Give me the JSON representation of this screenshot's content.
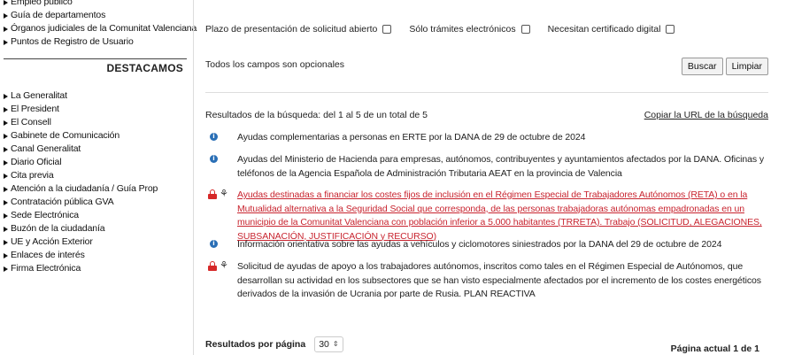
{
  "sidebar": {
    "top_items": [
      {
        "label": "Empleo público"
      },
      {
        "label": "Guía de departamentos"
      },
      {
        "label": "Órganos judiciales de la Comunitat Valenciana"
      },
      {
        "label": "Puntos de Registro de Usuario"
      }
    ],
    "section_title": "DESTACAMOS",
    "items": [
      {
        "label": "La Generalitat"
      },
      {
        "label": "El President"
      },
      {
        "label": "El Consell"
      },
      {
        "label": "Gabinete de Comunicación"
      },
      {
        "label": "Canal Generalitat"
      },
      {
        "label": "Diario Oficial"
      },
      {
        "label": "Cita previa"
      },
      {
        "label": "Atención a la ciudadanía / Guía Prop"
      },
      {
        "label": "Contratación pública GVA"
      },
      {
        "label": "Sede Electrónica"
      },
      {
        "label": "Buzón de la ciudadanía"
      },
      {
        "label": "UE y Acción Exterior"
      },
      {
        "label": "Enlaces de interés"
      },
      {
        "label": "Firma Electrónica"
      }
    ]
  },
  "filters": {
    "options": [
      {
        "label": "Plazo de presentación de solicitud abierto",
        "checked": false
      },
      {
        "label": "Sólo trámites electrónicos",
        "checked": false
      },
      {
        "label": "Necesitan certificado digital",
        "checked": false
      }
    ],
    "optional_note": "Todos los campos son opcionales",
    "search_button": "Buscar",
    "clear_button": "Limpiar"
  },
  "results": {
    "summary": "Resultados de la búsqueda: del 1 al 5 de un total de 5",
    "copy_link": "Copiar la URL de la búsqueda",
    "items": [
      {
        "type": "info",
        "icon": "info-icon",
        "text": "Ayudas complementarias a personas en ERTE por la DANA de 29 de octubre de 2024",
        "is_link": false
      },
      {
        "type": "info",
        "icon": "info-icon",
        "text": "Ayudas del Ministerio de Hacienda para empresas, autónomos, contribuyentes y ayuntamientos afectados por la DANA. Oficinas y teléfonos de la Agencia Española de Administración Tributaria AEAT en la provincia de Valencia",
        "is_link": false
      },
      {
        "type": "procedure",
        "icon": "lock-icon",
        "text": "Ayudas destinadas a financiar los costes fijos de inclusión en el Régimen Especial de Trabajadores Autónomos (RETA) o en la Mutualidad alternativa a la Seguridad Social que corresponda, de las personas trabajadoras autónomas empadronadas en un municipio de la Comunitat Valenciana con población inferior a 5.000 habitantes (TRRETA). Trabajo (SOLICITUD, ALEGACIONES, SUBSANACIÓN, JUSTIFICACIÓN y RECURSO)",
        "is_link": true
      },
      {
        "type": "info",
        "icon": "info-icon",
        "text": "Información orientativa sobre las ayudas a vehículos y ciclomotores siniestrados por la DANA del 29 de octubre de 2024",
        "is_link": false
      },
      {
        "type": "procedure",
        "icon": "lock-icon",
        "text": "Solicitud de ayudas de apoyo a los trabajadores autónomos, inscritos como tales en el Régimen Especial de Autónomos, que desarrollan su actividad en los subsectores que se han visto especialmente afectados por el incremento de los costes energéticos derivados de la invasión de Ucrania por parte de Rusia. PLAN REACTIVA",
        "is_link": false
      }
    ]
  },
  "pagination": {
    "per_page_label": "Resultados por página",
    "per_page_value": "30",
    "page_info": "Página actual 1 de 1"
  },
  "colors": {
    "link_red": "#c8242f",
    "info_blue": "#2a6fb6",
    "lock_red": "#d62828"
  }
}
